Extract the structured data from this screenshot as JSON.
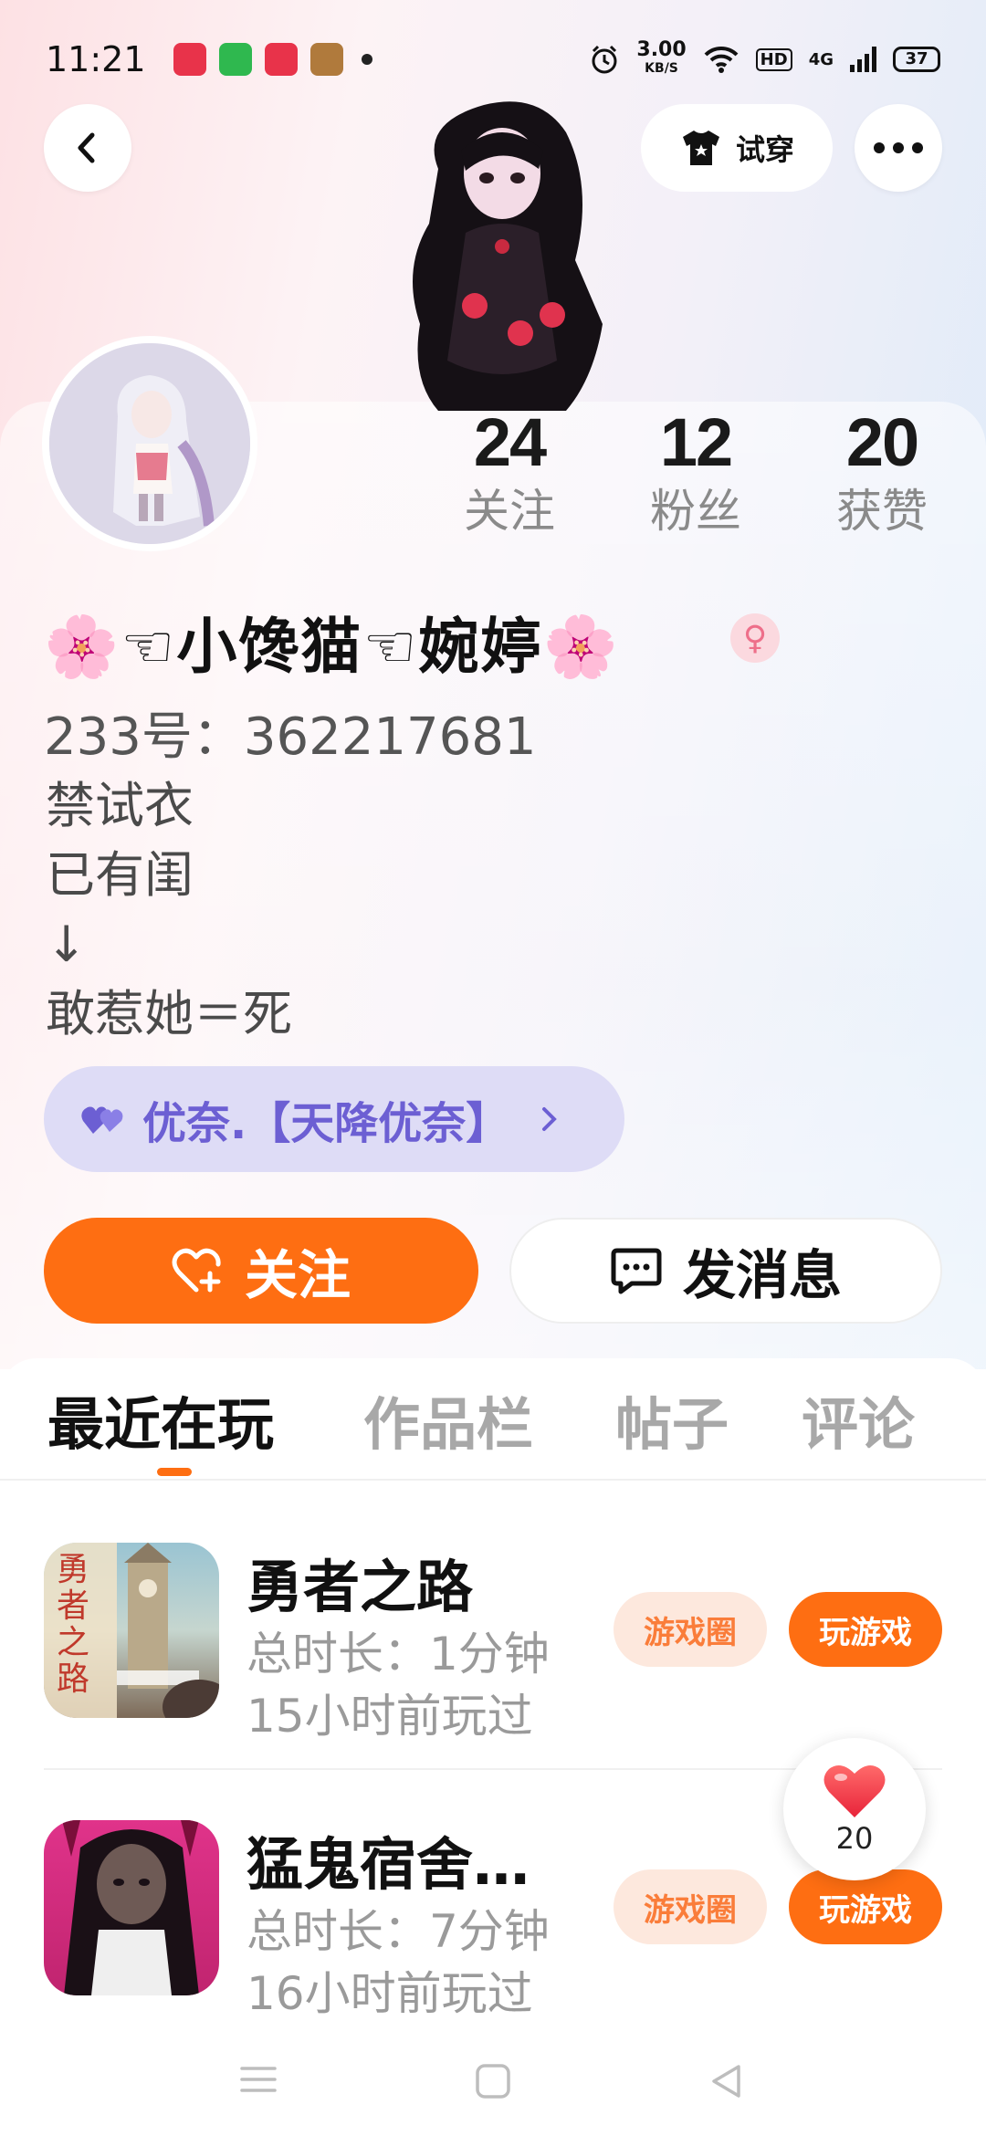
{
  "status_bar": {
    "time": "11:21",
    "net_speed_value": "3.00",
    "net_speed_unit": "KB/S",
    "hd_label": "HD",
    "network_label": "4G",
    "battery": "37"
  },
  "header": {
    "tryon_label": "试穿"
  },
  "stats": {
    "following_count": "24",
    "following_label": "关注",
    "fans_count": "12",
    "fans_label": "粉丝",
    "likes_count": "20",
    "likes_label": "获赞"
  },
  "profile": {
    "nickname": "🌸☜小馋猫☜婉婷🌸",
    "gender_symbol": "♀",
    "uid_label": "233号：",
    "uid": "362217681",
    "bio": "禁试衣\n已有闺\n↓\n敢惹她＝死",
    "union_name": "优奈.【天降优奈】"
  },
  "actions": {
    "follow_label": "关注",
    "message_label": "发消息"
  },
  "tabs": [
    {
      "label": "最近在玩",
      "active": true
    },
    {
      "label": "作品栏",
      "active": false
    },
    {
      "label": "帖子",
      "active": false
    },
    {
      "label": "评论",
      "active": false
    }
  ],
  "games": [
    {
      "title": "勇者之路",
      "thumb_text": "勇\n者\n之\n路",
      "duration": "总时长：1分钟",
      "last_played": "15小时前玩过",
      "circle_label": "游戏圈",
      "play_label": "玩游戏"
    },
    {
      "title": "猛鬼宿舍…",
      "duration": "总时长：7分钟",
      "last_played": "16小时前玩过",
      "circle_label": "游戏圈",
      "play_label": "玩游戏"
    }
  ],
  "like_float": {
    "count": "20"
  },
  "colors": {
    "accent": "#fe6e12",
    "union_bg": "#dedcf6",
    "union_text": "#6c5fd3",
    "circle_pill_bg": "#fde8dd"
  }
}
